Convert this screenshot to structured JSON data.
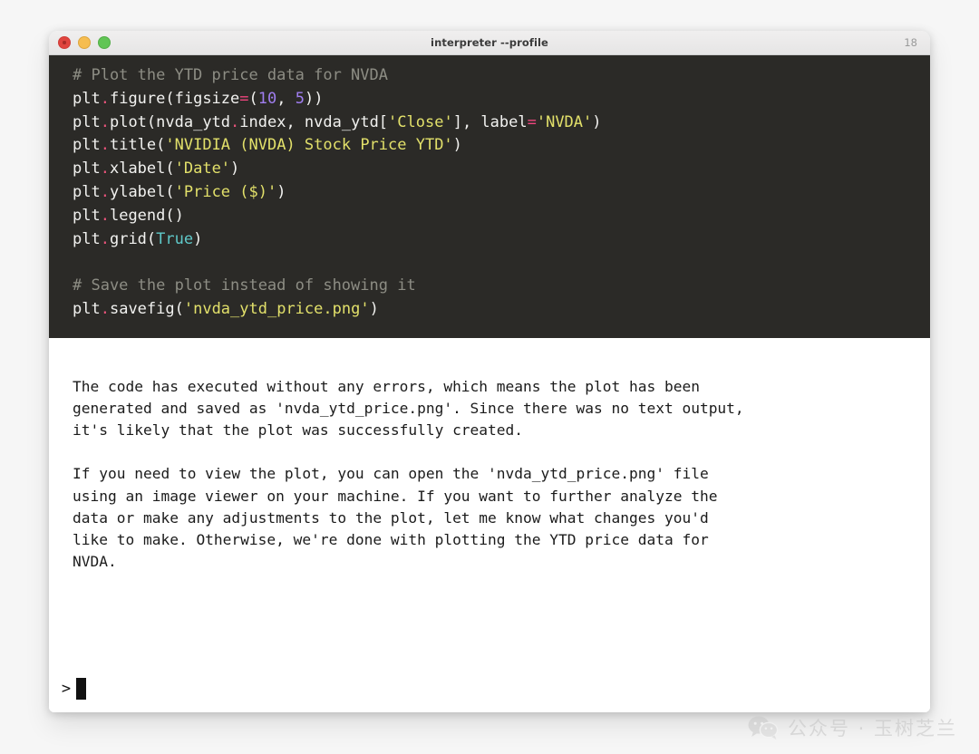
{
  "window": {
    "title": "interpreter --profile",
    "line_counter": "18",
    "traffic_lights": [
      {
        "name": "close-button",
        "color": "#e0443e"
      },
      {
        "name": "minimize-button",
        "color": "#f6bd50"
      },
      {
        "name": "maximize-button",
        "color": "#61c555"
      }
    ]
  },
  "code_block": {
    "background": "#2b2a27",
    "lines": [
      [
        {
          "t": "comment",
          "s": "# Plot the YTD price data for NVDA"
        }
      ],
      [
        {
          "t": "plain",
          "s": "plt"
        },
        {
          "t": "dot",
          "s": "."
        },
        {
          "t": "plain",
          "s": "figure(figsize"
        },
        {
          "t": "op",
          "s": "="
        },
        {
          "t": "plain",
          "s": "("
        },
        {
          "t": "num",
          "s": "10"
        },
        {
          "t": "plain",
          "s": ", "
        },
        {
          "t": "num",
          "s": "5"
        },
        {
          "t": "plain",
          "s": "))"
        }
      ],
      [
        {
          "t": "plain",
          "s": "plt"
        },
        {
          "t": "dot",
          "s": "."
        },
        {
          "t": "plain",
          "s": "plot(nvda_ytd"
        },
        {
          "t": "dot",
          "s": "."
        },
        {
          "t": "plain",
          "s": "index, nvda_ytd["
        },
        {
          "t": "str",
          "s": "'Close'"
        },
        {
          "t": "plain",
          "s": "], label"
        },
        {
          "t": "op",
          "s": "="
        },
        {
          "t": "str",
          "s": "'NVDA'"
        },
        {
          "t": "plain",
          "s": ")"
        }
      ],
      [
        {
          "t": "plain",
          "s": "plt"
        },
        {
          "t": "dot",
          "s": "."
        },
        {
          "t": "plain",
          "s": "title("
        },
        {
          "t": "str",
          "s": "'NVIDIA (NVDA) Stock Price YTD'"
        },
        {
          "t": "plain",
          "s": ")"
        }
      ],
      [
        {
          "t": "plain",
          "s": "plt"
        },
        {
          "t": "dot",
          "s": "."
        },
        {
          "t": "plain",
          "s": "xlabel("
        },
        {
          "t": "str",
          "s": "'Date'"
        },
        {
          "t": "plain",
          "s": ")"
        }
      ],
      [
        {
          "t": "plain",
          "s": "plt"
        },
        {
          "t": "dot",
          "s": "."
        },
        {
          "t": "plain",
          "s": "ylabel("
        },
        {
          "t": "str",
          "s": "'Price ($)'"
        },
        {
          "t": "plain",
          "s": ")"
        }
      ],
      [
        {
          "t": "plain",
          "s": "plt"
        },
        {
          "t": "dot",
          "s": "."
        },
        {
          "t": "plain",
          "s": "legend()"
        }
      ],
      [
        {
          "t": "plain",
          "s": "plt"
        },
        {
          "t": "dot",
          "s": "."
        },
        {
          "t": "plain",
          "s": "grid("
        },
        {
          "t": "const",
          "s": "True"
        },
        {
          "t": "plain",
          "s": ")"
        }
      ],
      [
        {
          "t": "plain",
          "s": ""
        }
      ],
      [
        {
          "t": "comment",
          "s": "# Save the plot instead of showing it"
        }
      ],
      [
        {
          "t": "plain",
          "s": "plt"
        },
        {
          "t": "dot",
          "s": "."
        },
        {
          "t": "plain",
          "s": "savefig("
        },
        {
          "t": "str",
          "s": "'nvda_ytd_price.png'"
        },
        {
          "t": "plain",
          "s": ")"
        }
      ]
    ]
  },
  "assistant_output": {
    "paragraph_1": "The code has executed without any errors, which means the plot has been\ngenerated and saved as 'nvda_ytd_price.png'. Since there was no text output,\nit's likely that the plot was successfully created.",
    "paragraph_2": "If you need to view the plot, you can open the 'nvda_ytd_price.png' file\nusing an image viewer on your machine. If you want to further analyze the\ndata or make any adjustments to the plot, let me know what changes you'd\nlike to make. Otherwise, we're done with plotting the YTD price data for\nNVDA."
  },
  "prompt": {
    "symbol": ">",
    "input_value": "",
    "cursor": "block"
  },
  "watermark": {
    "icon": "wechat-icon",
    "text": "公众号 · 玉树芝兰",
    "color": "#c4c4c4"
  }
}
